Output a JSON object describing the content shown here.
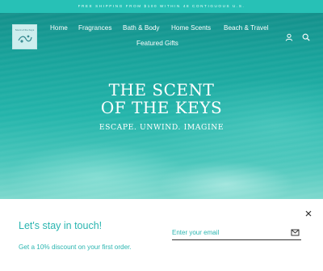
{
  "announcement": "FREE SHIPPING FROM $100 WITHIN 48 CONTIGUOUS U.S.",
  "logo": {
    "text": "Scent of the Keys"
  },
  "nav": {
    "items": [
      "Home",
      "Fragrances",
      "Bath & Body",
      "Home Scents",
      "Beach & Travel",
      "Featured Gifts"
    ]
  },
  "header_icons": [
    "account-icon",
    "search-icon"
  ],
  "hero": {
    "headline_line1": "THE SCENT",
    "headline_line2": "OF THE KEYS",
    "tagline": "ESCAPE. UNWIND. IMAGINE"
  },
  "popup": {
    "title": "Let's stay in touch!",
    "subtitle": "Get a 10% discount on your first order.",
    "email_placeholder": "Enter your email",
    "close_icon": "close-icon",
    "submit_icon": "mail-send-icon"
  },
  "colors": {
    "accent": "#2ab5b0",
    "announcement_bg": "#27c1b6",
    "hero_water": "#1fa89f"
  }
}
